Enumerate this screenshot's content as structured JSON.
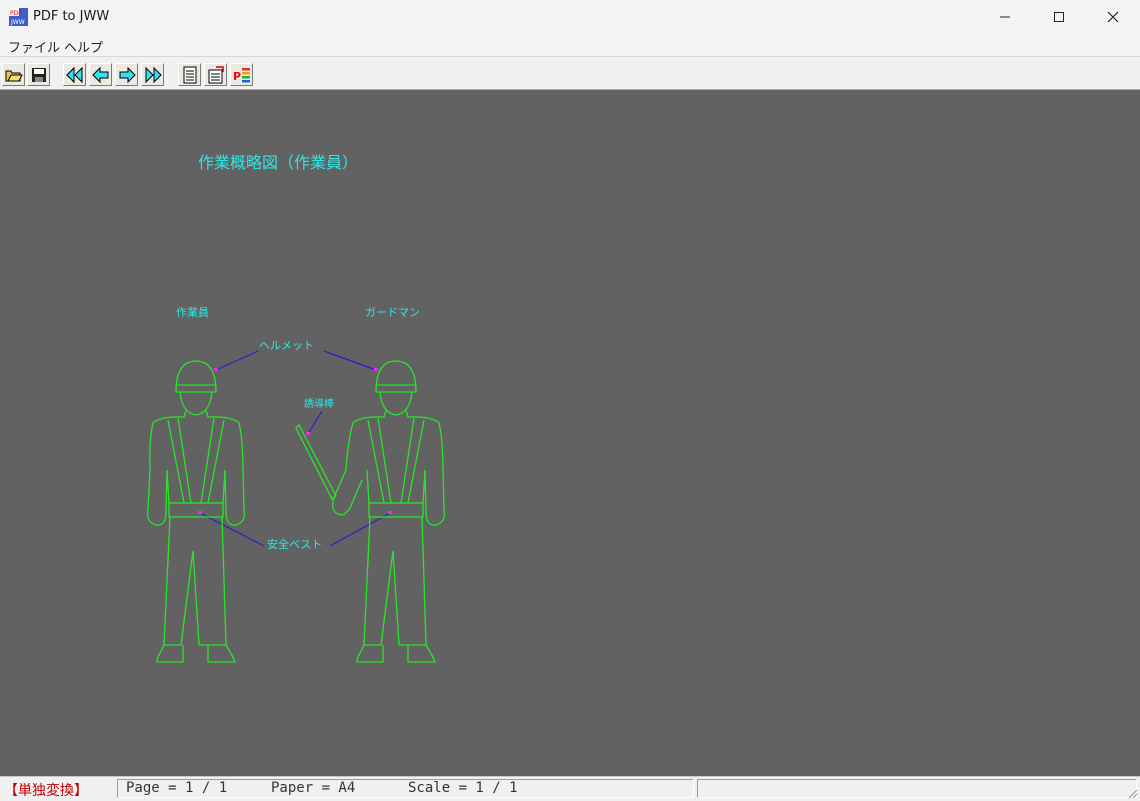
{
  "window": {
    "title": "PDF to JWW",
    "icon_text": "PDF JWW"
  },
  "menu": [
    {
      "label": "ファイル"
    },
    {
      "label": "ヘルプ"
    }
  ],
  "toolbar": {
    "buttons": [
      {
        "name": "open-icon"
      },
      {
        "name": "save-icon"
      },
      {
        "name": "first-page-icon"
      },
      {
        "name": "prev-page-icon"
      },
      {
        "name": "next-page-icon"
      },
      {
        "name": "last-page-icon"
      },
      {
        "name": "list-icon"
      },
      {
        "name": "layer-icon"
      },
      {
        "name": "pdf-convert-icon"
      }
    ]
  },
  "drawing": {
    "title": "作業概略図（作業員）",
    "label_worker": "作業員",
    "label_guardman": "ガードマン",
    "label_helmet": "ヘルメット",
    "label_baton": "誘導棒",
    "label_vest": "安全ベスト",
    "colors": {
      "background": "#626262",
      "figure": "#27e627",
      "text": "#2ee6e6",
      "leader": "#2222cc",
      "marker": "#e62ee6"
    }
  },
  "status": {
    "mode": "【単独変換】",
    "page": "Page = 1 / 1",
    "paper": "Paper = A4",
    "scale": "Scale = 1 / 1"
  }
}
